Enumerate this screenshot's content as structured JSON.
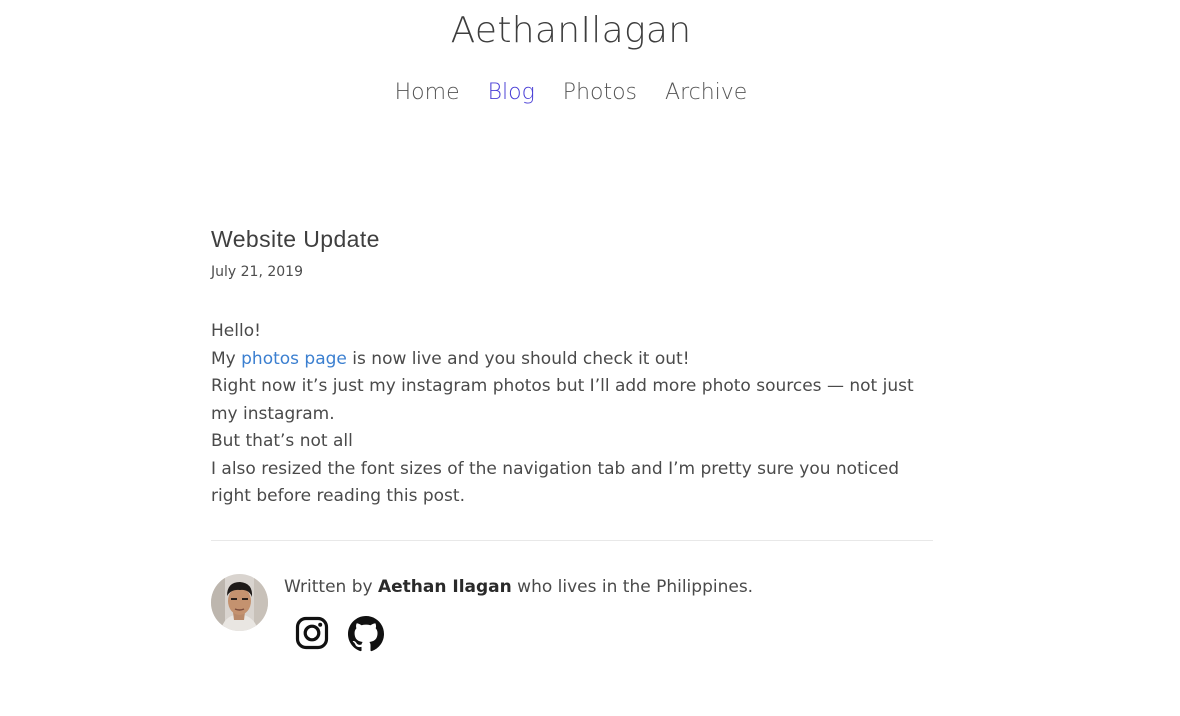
{
  "header": {
    "site_title": "AethanIlagan"
  },
  "nav": {
    "items": [
      {
        "label": "Home"
      },
      {
        "label": "Blog"
      },
      {
        "label": "Photos"
      },
      {
        "label": "Archive"
      }
    ],
    "active": "Blog"
  },
  "post": {
    "title": "Website Update",
    "date": "July 21, 2019",
    "line1": "Hello!",
    "line2_before": "My ",
    "line2_link": "photos page",
    "line2_after": " is now live and you should check it out!",
    "line3": "Right now it’s just my instagram photos but I’ll add more photo sources — not just my instagram.",
    "line4": "But that’s not all",
    "line5": "I also resized the font sizes of the navigation tab and I’m pretty sure you noticed right before reading this post."
  },
  "author": {
    "prefix": "Written by ",
    "name": "Aethan Ilagan",
    "suffix": " who lives in the Philippines."
  },
  "social": {
    "icons": [
      "instagram-icon",
      "github-icon"
    ]
  },
  "colors": {
    "nav_active": "#4a3fd6",
    "link": "#3b7fd0"
  }
}
